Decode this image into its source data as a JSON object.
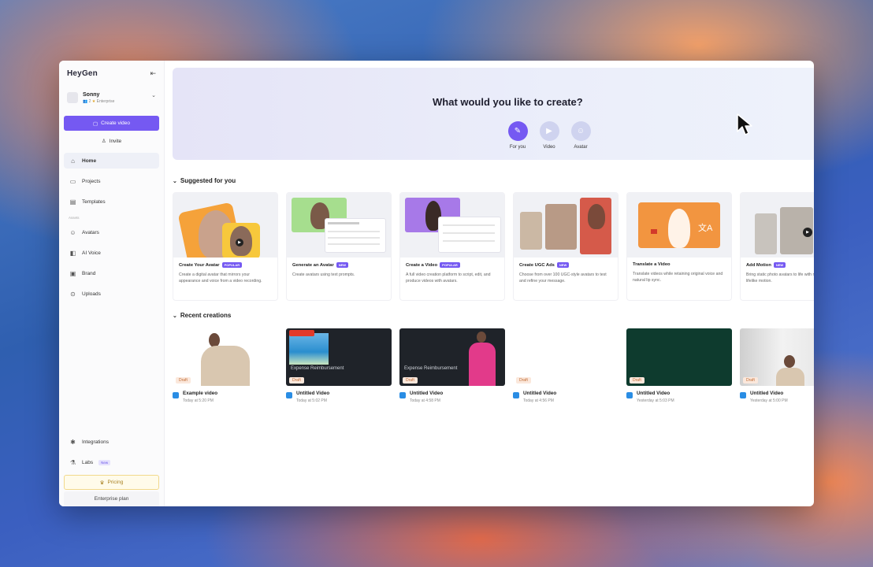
{
  "app": {
    "logo": "HeyGen"
  },
  "account": {
    "name": "Sonny",
    "members": "2",
    "plan": "Enterprise"
  },
  "sidebar": {
    "create_label": "Create video",
    "invite_label": "Invite",
    "items": [
      {
        "label": "Home",
        "icon": "home-icon"
      },
      {
        "label": "Projects",
        "icon": "folder-icon"
      },
      {
        "label": "Templates",
        "icon": "template-icon"
      }
    ],
    "assets_section": "Assets",
    "asset_items": [
      {
        "label": "Avatars",
        "icon": "avatar-icon"
      },
      {
        "label": "AI Voice",
        "icon": "voice-icon"
      },
      {
        "label": "Brand",
        "icon": "brand-icon"
      },
      {
        "label": "Uploads",
        "icon": "upload-icon"
      }
    ],
    "bottom_items": [
      {
        "label": "Integrations",
        "icon": "integrations-icon"
      },
      {
        "label": "Labs",
        "icon": "labs-icon",
        "badge": "New"
      }
    ],
    "pricing_label": "Pricing",
    "plan_label": "Enterprise plan"
  },
  "hero": {
    "title": "What would you like to create?",
    "tabs": [
      {
        "label": "For you",
        "icon": "wand-icon",
        "active": true
      },
      {
        "label": "Video",
        "icon": "video-icon",
        "active": false
      },
      {
        "label": "Avatar",
        "icon": "avatar-icon",
        "active": false
      }
    ]
  },
  "suggested": {
    "title": "Suggested for you",
    "cards": [
      {
        "title": "Create Your Avatar",
        "tag": "POPULAR",
        "desc": "Create a digital avatar that mirrors your appearance and voice from a video recording."
      },
      {
        "title": "Generate an Avatar",
        "tag": "NEW",
        "desc": "Create avatars using text prompts."
      },
      {
        "title": "Create a Video",
        "tag": "POPULAR",
        "desc": "A full video creation platform to script, edit, and produce videos with avatars."
      },
      {
        "title": "Create UGC Ads",
        "tag": "NEW",
        "desc": "Choose from over 100 UGC-style avatars to test and refine your message."
      },
      {
        "title": "Translate a Video",
        "tag": "",
        "desc": "Translate videos while retaining original voice and natural lip sync."
      },
      {
        "title": "Add Motion",
        "tag": "NEW",
        "desc": "Bring static photo avatars to life with realistic, lifelike motion."
      }
    ]
  },
  "recent": {
    "title": "Recent creations",
    "draft_label": "Draft",
    "items": [
      {
        "title": "Example video",
        "date": "Today at 5:20 PM"
      },
      {
        "title": "Untitled Video",
        "date": "Today at 5:02 PM"
      },
      {
        "title": "Untitled Video",
        "date": "Today at 4:58 PM"
      },
      {
        "title": "Untitled Video",
        "date": "Today at 4:56 PM"
      },
      {
        "title": "Untitled Video",
        "date": "Yesterday at 5:03 PM"
      },
      {
        "title": "Untitled Video",
        "date": "Yesterday at 5:00 PM"
      }
    ],
    "thumb_text": "Expense Reimbursement"
  },
  "colors": {
    "accent": "#7559f2",
    "draft": "#c06a32",
    "pricing": "#a98122"
  }
}
